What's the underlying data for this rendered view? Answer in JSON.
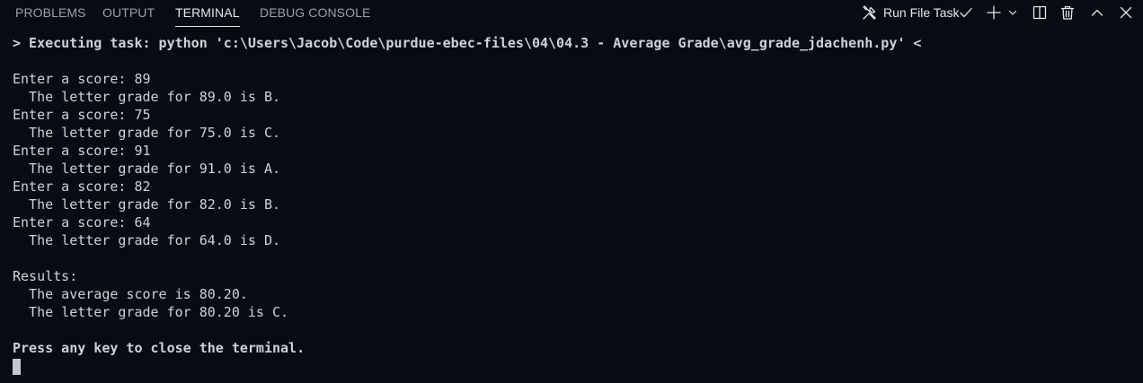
{
  "tabs": [
    {
      "label": "PROBLEMS",
      "active": false
    },
    {
      "label": "OUTPUT",
      "active": false
    },
    {
      "label": "TERMINAL",
      "active": true
    },
    {
      "label": "DEBUG CONSOLE",
      "active": false
    }
  ],
  "toolbar": {
    "task_name": "Run File Task",
    "icons": [
      "tools-icon",
      "check-icon",
      "plus-icon",
      "chevron-down-icon",
      "split-icon",
      "trash-icon",
      "chevron-up-icon",
      "close-icon"
    ]
  },
  "terminal": {
    "command": "> Executing task: python 'c:\\Users\\Jacob\\Code\\purdue-ebec-files\\04\\04.3 - Average Grade\\avg_grade_jdachenh.py' <",
    "lines": [
      "",
      "Enter a score: 89",
      "  The letter grade for 89.0 is B.",
      "Enter a score: 75",
      "  The letter grade for 75.0 is C.",
      "Enter a score: 91",
      "  The letter grade for 91.0 is A.",
      "Enter a score: 82",
      "  The letter grade for 82.0 is B.",
      "Enter a score: 64",
      "  The letter grade for 64.0 is D.",
      "",
      "Results:",
      "  The average score is 80.20.",
      "  The letter grade for 80.20 is C.",
      ""
    ],
    "footer": "Press any key to close the terminal."
  },
  "colors": {
    "background": "#080b12",
    "text": "#cdd2d9",
    "tab_inactive": "#9aa1ab",
    "tab_active": "#e6e8eb"
  }
}
